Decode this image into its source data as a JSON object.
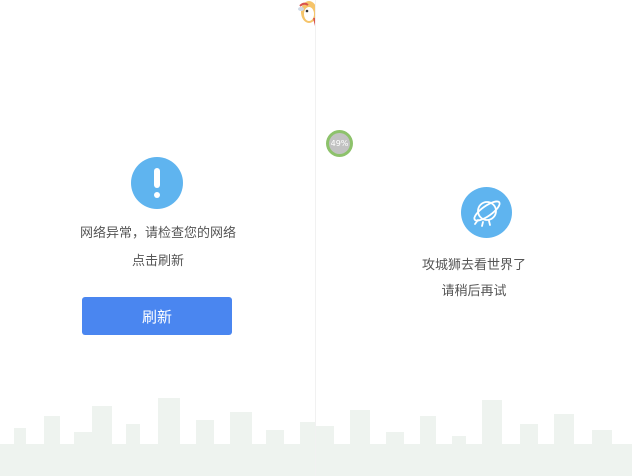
{
  "left_panel": {
    "icon": "exclamation-icon",
    "message_line1": "网络异常，请检查您的网络",
    "message_line2": "点击刷新",
    "refresh_label": "刷新"
  },
  "right_panel": {
    "progress_text": "49%",
    "icon": "planet-icon",
    "message_line1": "攻城狮去看世界了",
    "message_line2": "请稍后再试"
  },
  "colors": {
    "accent_blue": "#5fb4ef",
    "button_blue": "#4a86f0",
    "progress_green": "#8dc26b",
    "skyline": "#eef3ef"
  }
}
